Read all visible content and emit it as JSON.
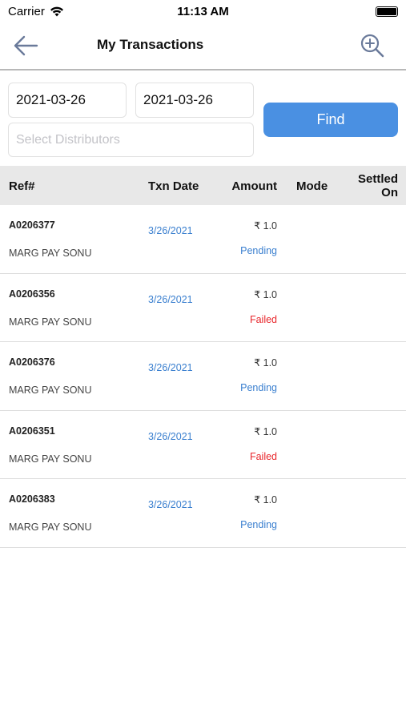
{
  "status_bar": {
    "carrier": "Carrier",
    "time": "11:13 AM"
  },
  "nav": {
    "title": "My Transactions",
    "back_icon": "arrow-left-icon",
    "zoom_icon": "zoom-in-icon"
  },
  "filters": {
    "from_date": "2021-03-26",
    "to_date": "2021-03-26",
    "distributor_placeholder": "Select Distributors",
    "find_label": "Find"
  },
  "table": {
    "headers": {
      "ref": "Ref#",
      "date": "Txn Date",
      "amount": "Amount",
      "mode": "Mode",
      "settled": "Settled On"
    },
    "rows": [
      {
        "ref": "A0206377",
        "name": "MARG PAY SONU",
        "date": "3/26/2021",
        "amount": "₹ 1.0",
        "status": "Pending",
        "status_color": "#3a7fcf"
      },
      {
        "ref": "A0206356",
        "name": "MARG PAY SONU",
        "date": "3/26/2021",
        "amount": "₹ 1.0",
        "status": "Failed",
        "status_color": "#e8262b"
      },
      {
        "ref": "A0206376",
        "name": "MARG PAY SONU",
        "date": "3/26/2021",
        "amount": "₹ 1.0",
        "status": "Pending",
        "status_color": "#3a7fcf"
      },
      {
        "ref": "A0206351",
        "name": "MARG PAY SONU",
        "date": "3/26/2021",
        "amount": "₹ 1.0",
        "status": "Failed",
        "status_color": "#e8262b"
      },
      {
        "ref": "A0206383",
        "name": "MARG PAY SONU",
        "date": "3/26/2021",
        "amount": "₹ 1.0",
        "status": "Pending",
        "status_color": "#3a7fcf"
      }
    ]
  },
  "colors": {
    "accent": "#4a90e2",
    "pending": "#3a7fcf",
    "failed": "#e8262b"
  }
}
